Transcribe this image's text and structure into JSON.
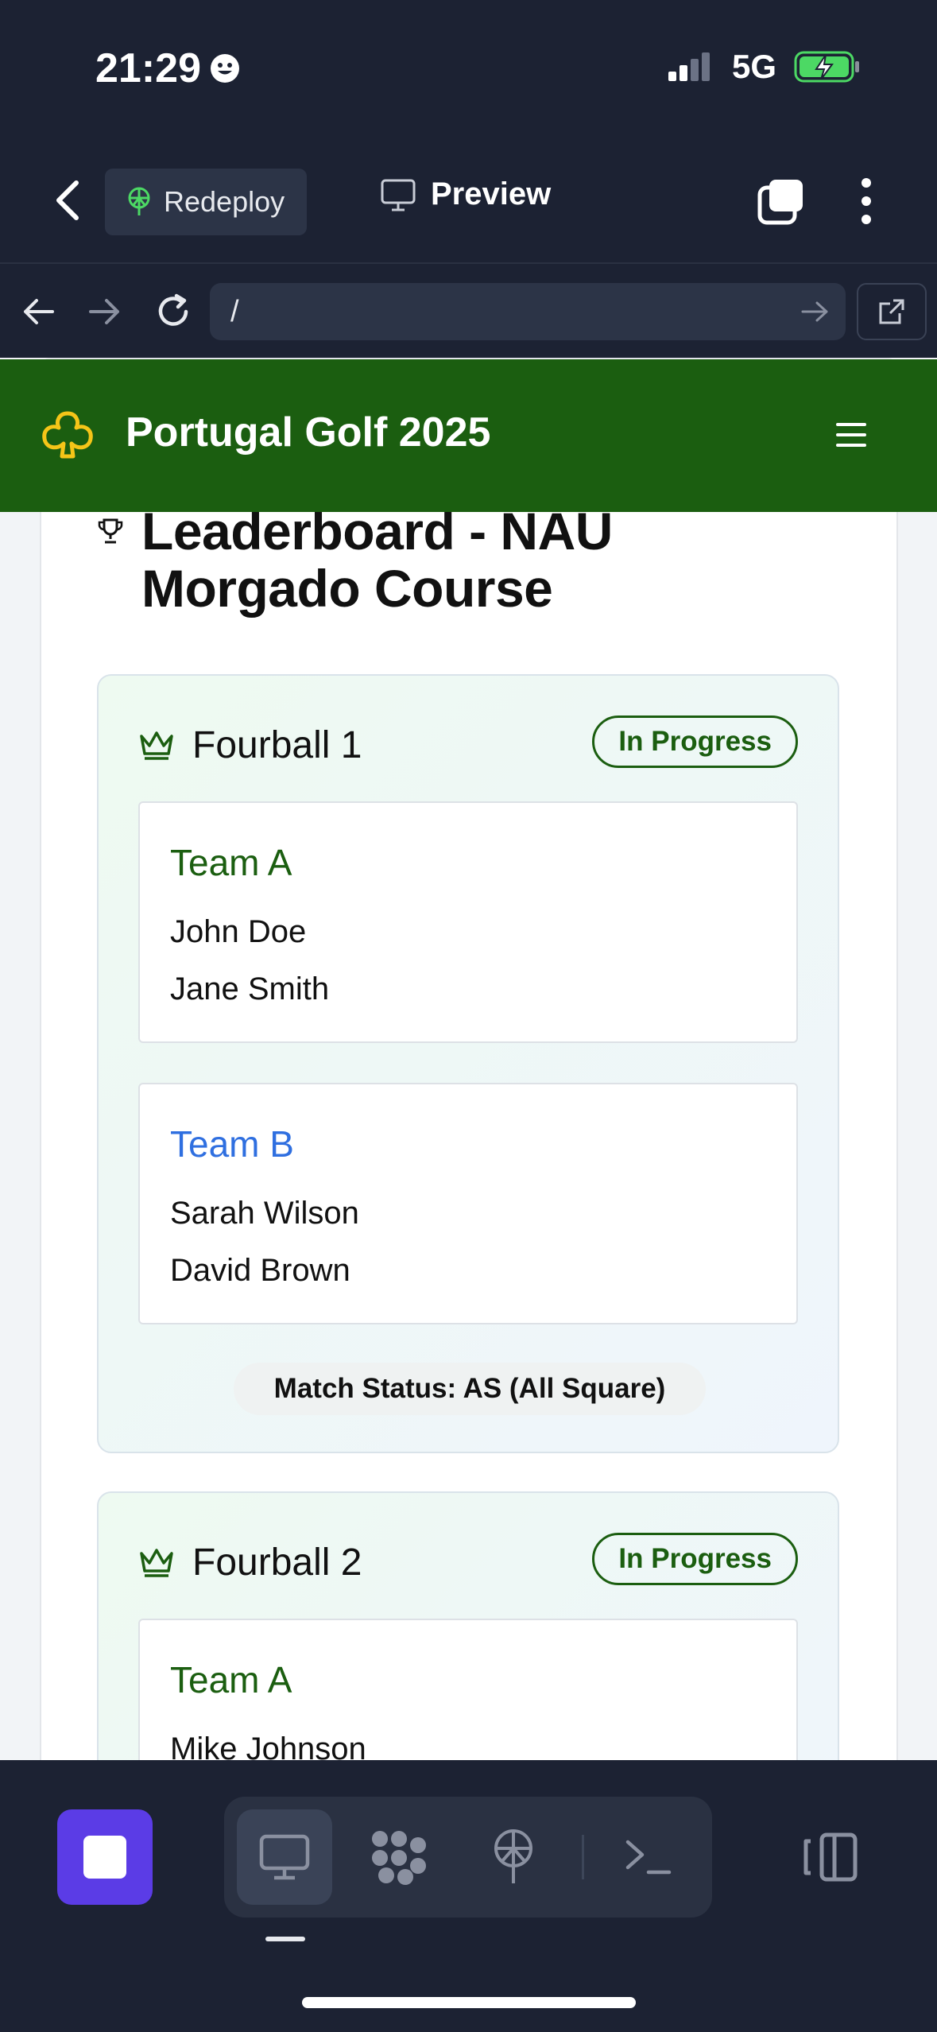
{
  "status": {
    "time": "21:29",
    "network": "5G"
  },
  "toolbar": {
    "redeploy_label": "Redeploy",
    "preview_label": "Preview"
  },
  "urlbar": {
    "url": "/"
  },
  "app": {
    "title": "Portugal Golf 2025"
  },
  "leaderboard": {
    "title_line1": "Leaderboard - NAU",
    "title_line2": "Morgado Course",
    "fourballs": [
      {
        "name": "Fourball 1",
        "status": "In Progress",
        "teams": [
          {
            "name": "Team A",
            "players": [
              "John Doe",
              "Jane Smith"
            ]
          },
          {
            "name": "Team B",
            "players": [
              "Sarah Wilson",
              "David Brown"
            ]
          }
        ],
        "match_status": "Match Status: AS (All Square)"
      },
      {
        "name": "Fourball 2",
        "status": "In Progress",
        "teams": [
          {
            "name": "Team A",
            "players": [
              "Mike Johnson"
            ]
          }
        ]
      }
    ]
  },
  "colors": {
    "brand_green": "#1b5e10",
    "team_b_blue": "#2f6fe0",
    "stop_purple": "#5b3ce6",
    "club_yellow": "#f5c518"
  },
  "icons": [
    "back-chevron-icon",
    "redeploy-icon",
    "monitor-icon",
    "tabs-icon",
    "kebab-icon",
    "arrow-left-icon",
    "arrow-right-icon",
    "reload-icon",
    "external-link-icon",
    "club-icon",
    "hamburger-icon",
    "trophy-icon",
    "crown-icon",
    "stop-icon",
    "packages-icon",
    "deploy-icon",
    "terminal-icon",
    "side-panel-icon"
  ]
}
